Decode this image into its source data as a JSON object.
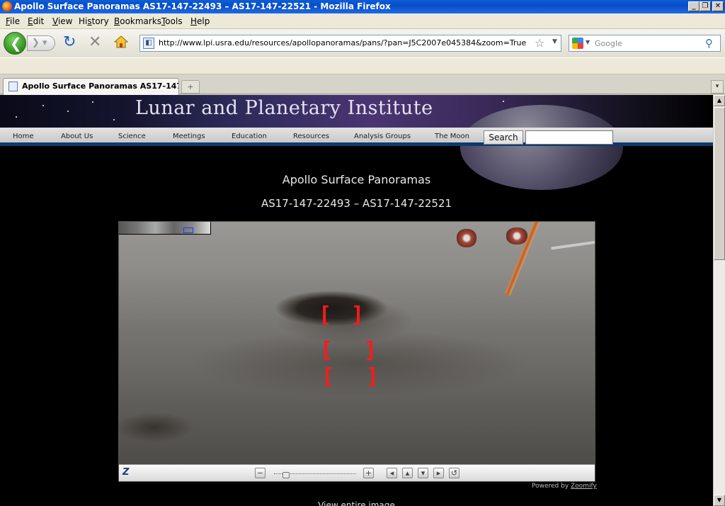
{
  "window": {
    "title": "Apollo Surface Panoramas AS17-147-22493 – AS17-147-22521 - Mozilla Firefox",
    "minimize": "_",
    "maximize": "❐",
    "close": "✕"
  },
  "menu": {
    "items": [
      {
        "label": "File",
        "key": "F"
      },
      {
        "label": "Edit",
        "key": "E"
      },
      {
        "label": "View",
        "key": "V"
      },
      {
        "label": "History",
        "key": "s"
      },
      {
        "label": "Bookmarks",
        "key": "B"
      },
      {
        "label": "Tools",
        "key": "T"
      },
      {
        "label": "Help",
        "key": "H"
      }
    ]
  },
  "toolbar": {
    "url": "http://www.lpi.usra.edu/resources/apollopanoramas/pans/?pan=J5C2007e045384&zoom=True",
    "search_placeholder": "Google",
    "back_glyph": "❮",
    "forward_glyph": "❯ ▾",
    "reload_glyph": "↻",
    "stop_glyph": "✕",
    "star_glyph": "☆",
    "dropdown_glyph": "▼",
    "search_glyph": "⚲"
  },
  "tabs": {
    "active": "Apollo Surface Panoramas AS17-147...",
    "new_tab": "+",
    "list": "▾"
  },
  "lpi": {
    "banner_title": "Lunar and Planetary Institute",
    "nav": [
      "Home",
      "About Us",
      "Science",
      "Meetings",
      "Education",
      "Resources",
      "Analysis Groups",
      "The Moon"
    ],
    "search_button": "Search",
    "search_value": ""
  },
  "page": {
    "title": "Apollo Surface Panoramas",
    "subtitle": "AS17-147-22493 – AS17-147-22521",
    "view_entire": "View entire image",
    "powered_by": "Powered by",
    "zoomify": "Zoomify"
  },
  "viewer": {
    "logo": "Z",
    "zoom_out": "−",
    "zoom_in": "+",
    "pan_left": "◂",
    "pan_up": "▴",
    "pan_down": "▾",
    "pan_right": "▸",
    "reset": "↺",
    "brackets": [
      "[",
      "]"
    ]
  },
  "scrollbar": {
    "up": "▲",
    "down": "▼"
  }
}
